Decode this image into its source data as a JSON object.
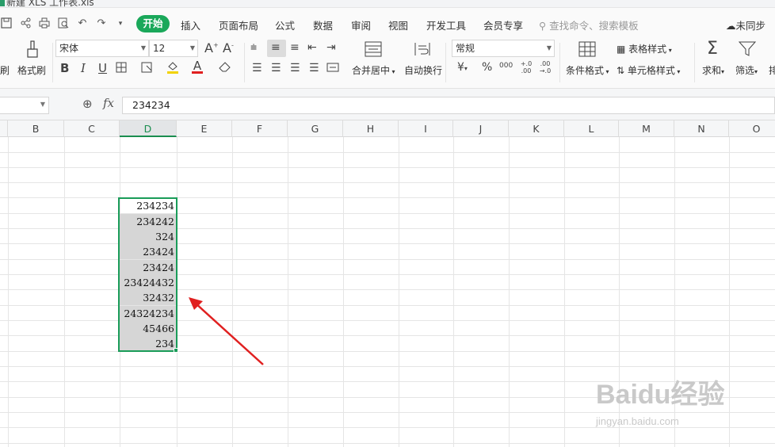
{
  "window": {
    "title_partial": "新建 XLS 工作表.xls"
  },
  "menu": {
    "active_tab": "开始",
    "tabs": [
      "插入",
      "页面布局",
      "公式",
      "数据",
      "审阅",
      "视图",
      "开发工具",
      "会员专享"
    ],
    "search_placeholder": "查找命令、搜索模板",
    "sync_label": "未同步"
  },
  "ribbon": {
    "format_painter": "格式刷",
    "font_name": "宋体",
    "font_size": "12",
    "merge_center": "合并居中",
    "wrap_text": "自动换行",
    "number_format": "常规",
    "conditional_format": "条件格式",
    "table_style": "表格样式",
    "cell_style": "单元格样式",
    "sum": "求和",
    "filter": "筛选",
    "currency_symbol": "¥",
    "percent_symbol": "%",
    "thousands_symbol": "000",
    "inc_decimal": "+.0 .00",
    "dec_decimal": ".00 →.0",
    "bold": "B",
    "italic": "I",
    "underline": "U",
    "font_color_letter": "A",
    "grow_font": "A",
    "shrink_font": "A",
    "partial_left_label": "刷",
    "partial_right_label": "排"
  },
  "formula_bar": {
    "name_box": "",
    "fx_label": "fx",
    "value": "234234"
  },
  "columns": [
    "B",
    "C",
    "D",
    "E",
    "F",
    "G",
    "H",
    "I",
    "J",
    "K",
    "L",
    "M",
    "N",
    "O"
  ],
  "active_column": "D",
  "cells": [
    "234234",
    "234242",
    "324",
    "23424",
    "23424",
    "23424432",
    "32432",
    "24324234",
    "45466",
    "234"
  ],
  "watermark": {
    "main": "Baidu经验",
    "sub": "jingyan.baidu.com"
  },
  "colors": {
    "accent": "#1aa85a",
    "selection": "#1a9c59",
    "arrow": "#e02020"
  }
}
